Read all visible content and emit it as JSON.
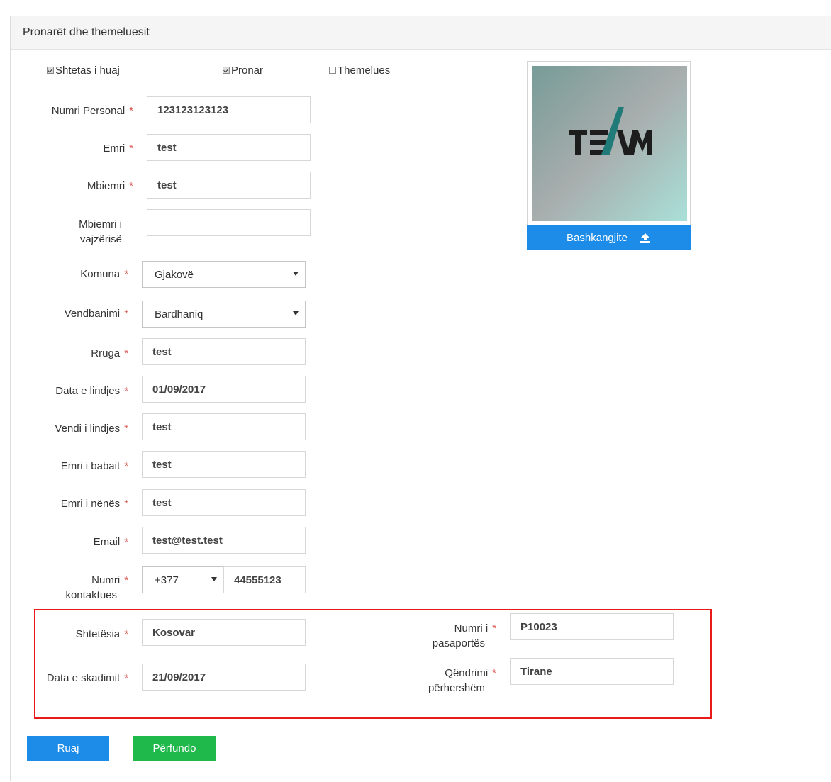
{
  "panel": {
    "title": "Pronarët dhe themeluesit"
  },
  "checkboxes": [
    {
      "label": "Shtetas i huaj",
      "checked": true
    },
    {
      "label": "Pronar",
      "checked": true
    },
    {
      "label": "Themelues",
      "checked": false
    }
  ],
  "required_mark": "*",
  "fields": {
    "numri_personal": {
      "label": "Numri Personal",
      "value": "123123123123"
    },
    "emri": {
      "label": "Emri",
      "value": "test"
    },
    "mbiemri": {
      "label": "Mbiemri",
      "value": "test"
    },
    "mbiemri_vajzerise": {
      "label_line1": "Mbiemri i",
      "label_line2": "vajzërisë",
      "value": ""
    },
    "komuna": {
      "label": "Komuna",
      "value": "Gjakovë"
    },
    "vendbanimi": {
      "label": "Vendbanimi",
      "value": "Bardhaniq"
    },
    "rruga": {
      "label": "Rruga",
      "value": "test"
    },
    "data_lindjes": {
      "label": "Data e lindjes",
      "value": "01/09/2017"
    },
    "vendi_lindjes": {
      "label": "Vendi i lindjes",
      "value": "test"
    },
    "emri_babait": {
      "label": "Emri i babait",
      "value": "test"
    },
    "emri_nenes": {
      "label": "Emri i nënës",
      "value": "test"
    },
    "email": {
      "label": "Email",
      "value": "test@test.test"
    },
    "numri_kontaktues": {
      "label_line1": "Numri",
      "label_line2": "kontaktues",
      "prefix": "+377",
      "value": "44555123"
    },
    "shtetesia": {
      "label": "Shtetësia",
      "value": "Kosovar"
    },
    "data_skadimit": {
      "label": "Data e skadimit",
      "value": "21/09/2017"
    },
    "numri_pasaportes": {
      "label_line1": "Numri i",
      "label_line2": "pasaportës",
      "value": "P10023"
    },
    "qendrimi": {
      "label_line1": "Qëndrimi",
      "label_line2": "përhershëm",
      "value": "Tirane"
    }
  },
  "photo": {
    "logo_text": "TEAM",
    "upload_label": "Bashkangjite"
  },
  "buttons": {
    "save": "Ruaj",
    "finish": "Përfundo"
  },
  "colors": {
    "primary": "#1d8ce8",
    "success": "#1fb84a",
    "required": "#d9534f",
    "highlight": "#e81a1a"
  }
}
